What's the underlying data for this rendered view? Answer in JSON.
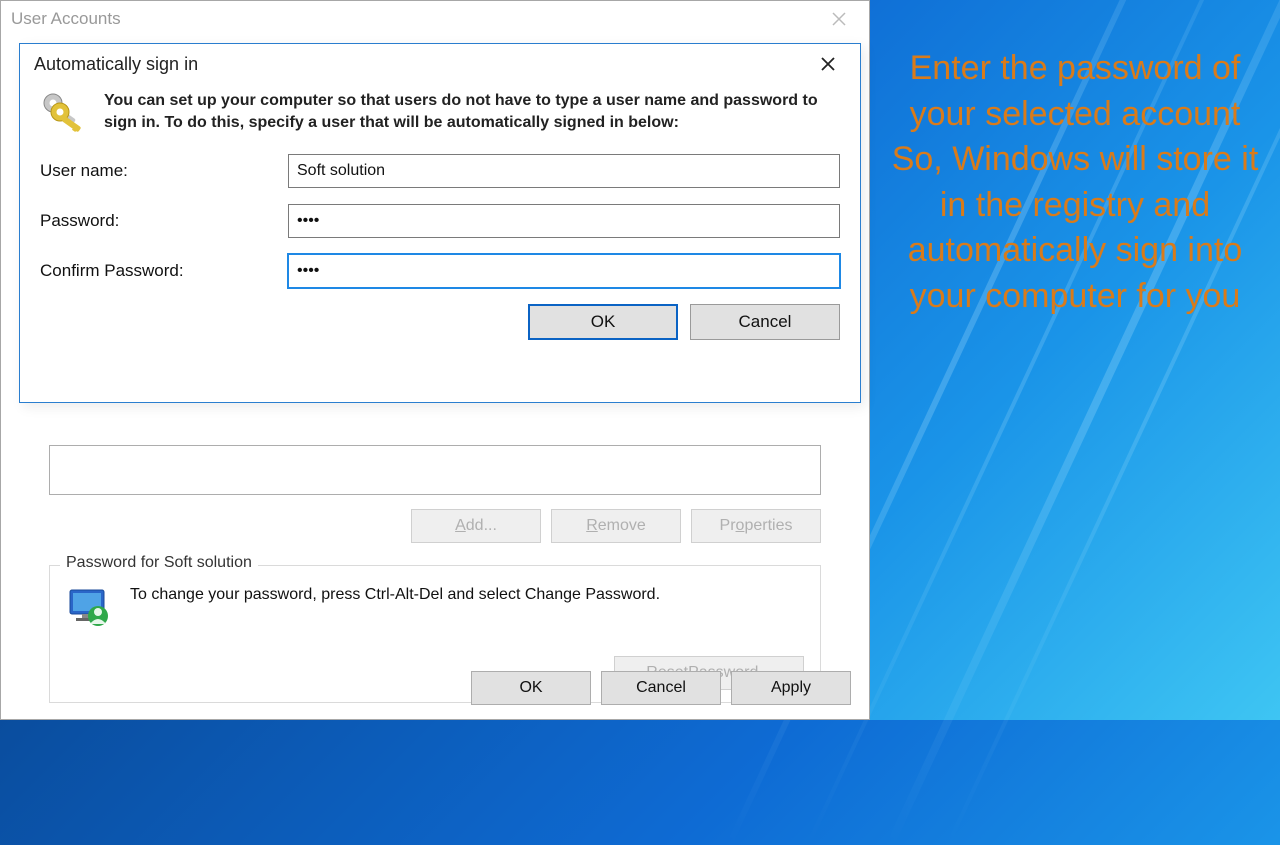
{
  "parent": {
    "title": "User Accounts",
    "buttons": {
      "add": "Add...",
      "remove": "Remove",
      "properties": "Properties",
      "reset_password": "Reset Password...",
      "ok": "OK",
      "cancel": "Cancel",
      "apply": "Apply"
    },
    "group": {
      "legend": "Password for Soft solution",
      "text": "To change your password, press Ctrl-Alt-Del and select Change Password."
    }
  },
  "child": {
    "title": "Automatically sign in",
    "intro": "You can set up your computer so that users do not have to type a user name and password to sign in. To do this, specify a user that will be automatically signed in below:",
    "labels": {
      "username": "User name:",
      "password": "Password:",
      "confirm": "Confirm Password:"
    },
    "values": {
      "username": "Soft solution",
      "password": "••••",
      "confirm": "••••"
    },
    "buttons": {
      "ok": "OK",
      "cancel": "Cancel"
    }
  },
  "side_instruction": "Enter the password of your  selected account So, Windows will store it in the registry and automatically sign into your computer for you",
  "icons": {
    "keys": "keys-icon",
    "user_monitor": "user-monitor-icon"
  }
}
